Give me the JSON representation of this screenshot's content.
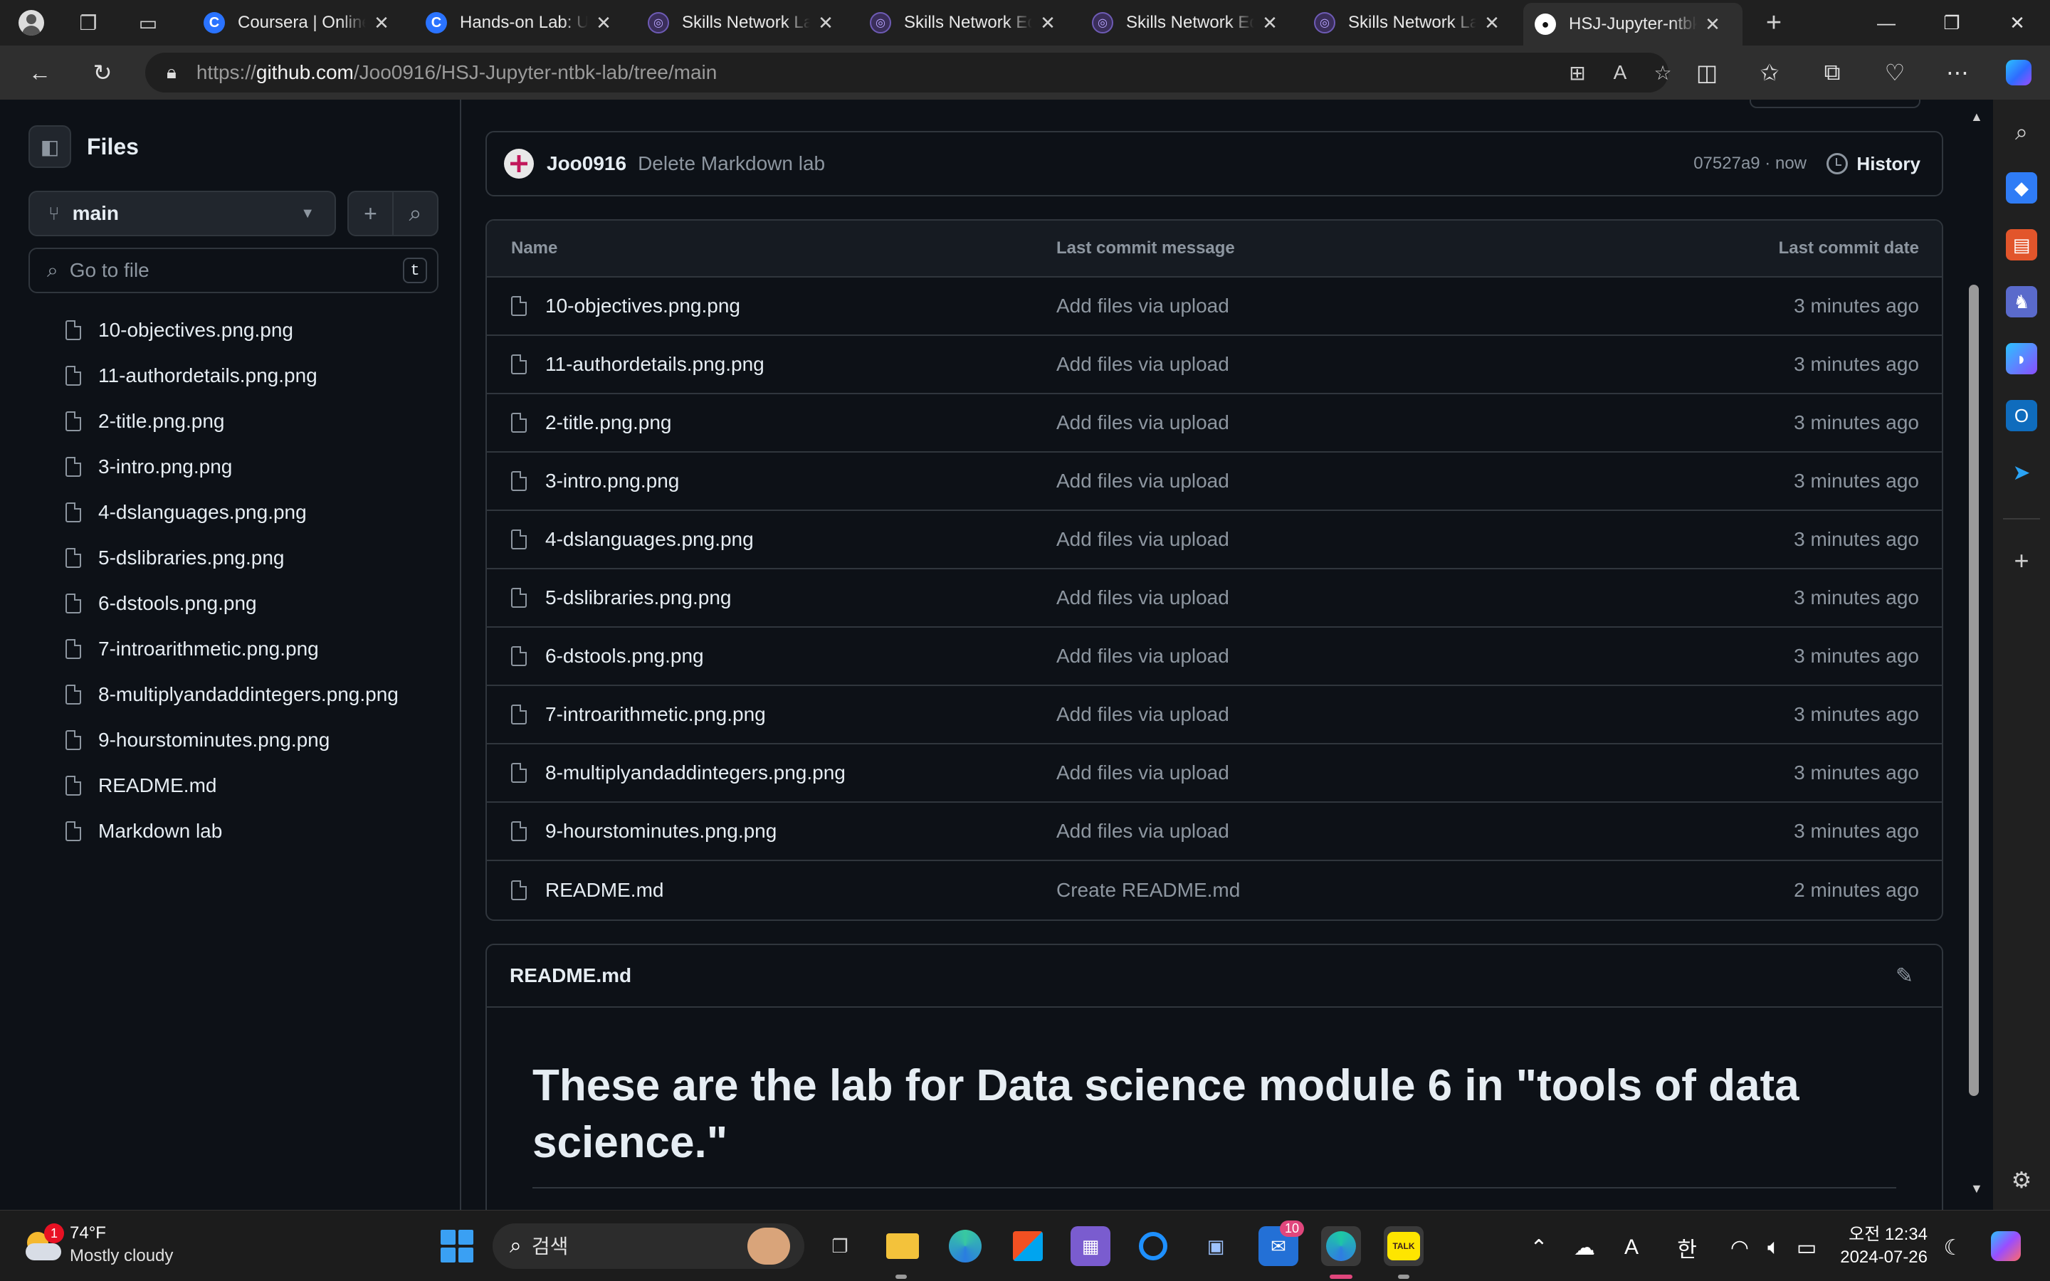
{
  "browser": {
    "tabs": [
      {
        "title": "",
        "icon": "profile-icon"
      },
      {
        "title": "Coursera | Online",
        "icon": "coursera-icon"
      },
      {
        "title": "Hands-on Lab: Us",
        "icon": "coursera-icon"
      },
      {
        "title": "Skills Network La",
        "icon": "skills-network-icon"
      },
      {
        "title": "Skills Network Ed",
        "icon": "skills-network-icon"
      },
      {
        "title": "Skills Network Ed",
        "icon": "skills-network-icon"
      },
      {
        "title": "Skills Network La",
        "icon": "skills-network-icon"
      },
      {
        "title": "HSJ-Jupyter-ntbk",
        "icon": "github-icon"
      }
    ],
    "url_prefix": "https://",
    "url_host": "github.com",
    "url_path": "/Joo0916/HSJ-Jupyter-ntbk-lab/tree/main"
  },
  "filetree": {
    "title": "Files",
    "branch": "main",
    "goto_placeholder": "Go to file",
    "goto_shortcut": "t",
    "items": [
      "10-objectives.png.png",
      "11-authordetails.png.png",
      "2-title.png.png",
      "3-intro.png.png",
      "4-dslanguages.png.png",
      "5-dslibraries.png.png",
      "6-dstools.png.png",
      "7-introarithmetic.png.png",
      "8-multiplyandaddintegers.png.png",
      "9-hourstominutes.png.png",
      "README.md",
      "Markdown lab"
    ]
  },
  "commit": {
    "user": "Joo0916",
    "message": "Delete Markdown lab",
    "meta": "07527a9 · now",
    "history_label": "History"
  },
  "table": {
    "headers": {
      "name": "Name",
      "message": "Last commit message",
      "date": "Last commit date"
    },
    "rows": [
      {
        "name": "10-objectives.png.png",
        "message": "Add files via upload",
        "date": "3 minutes ago"
      },
      {
        "name": "11-authordetails.png.png",
        "message": "Add files via upload",
        "date": "3 minutes ago"
      },
      {
        "name": "2-title.png.png",
        "message": "Add files via upload",
        "date": "3 minutes ago"
      },
      {
        "name": "3-intro.png.png",
        "message": "Add files via upload",
        "date": "3 minutes ago"
      },
      {
        "name": "4-dslanguages.png.png",
        "message": "Add files via upload",
        "date": "3 minutes ago"
      },
      {
        "name": "5-dslibraries.png.png",
        "message": "Add files via upload",
        "date": "3 minutes ago"
      },
      {
        "name": "6-dstools.png.png",
        "message": "Add files via upload",
        "date": "3 minutes ago"
      },
      {
        "name": "7-introarithmetic.png.png",
        "message": "Add files via upload",
        "date": "3 minutes ago"
      },
      {
        "name": "8-multiplyandaddintegers.png.png",
        "message": "Add files via upload",
        "date": "3 minutes ago"
      },
      {
        "name": "9-hourstominutes.png.png",
        "message": "Add files via upload",
        "date": "3 minutes ago"
      },
      {
        "name": "README.md",
        "message": "Create README.md",
        "date": "2 minutes ago"
      }
    ]
  },
  "readme": {
    "title": "README.md",
    "heading": "These are the lab for Data science module 6 in \"tools of data science.\""
  },
  "taskbar": {
    "weather_badge": "1",
    "temperature": "74°F",
    "condition": "Mostly cloudy",
    "search_placeholder": "검색",
    "mail_badge": "10",
    "kakao_label": "TALK",
    "ime_a": "A",
    "ime_han": "한",
    "time": "오전 12:34",
    "date": "2024-07-26"
  },
  "colors": {
    "page_bg": "#0d1117",
    "border": "#30363d",
    "text": "#e6edf3",
    "muted": "#8d96a0",
    "browser_chrome": "#202020"
  }
}
